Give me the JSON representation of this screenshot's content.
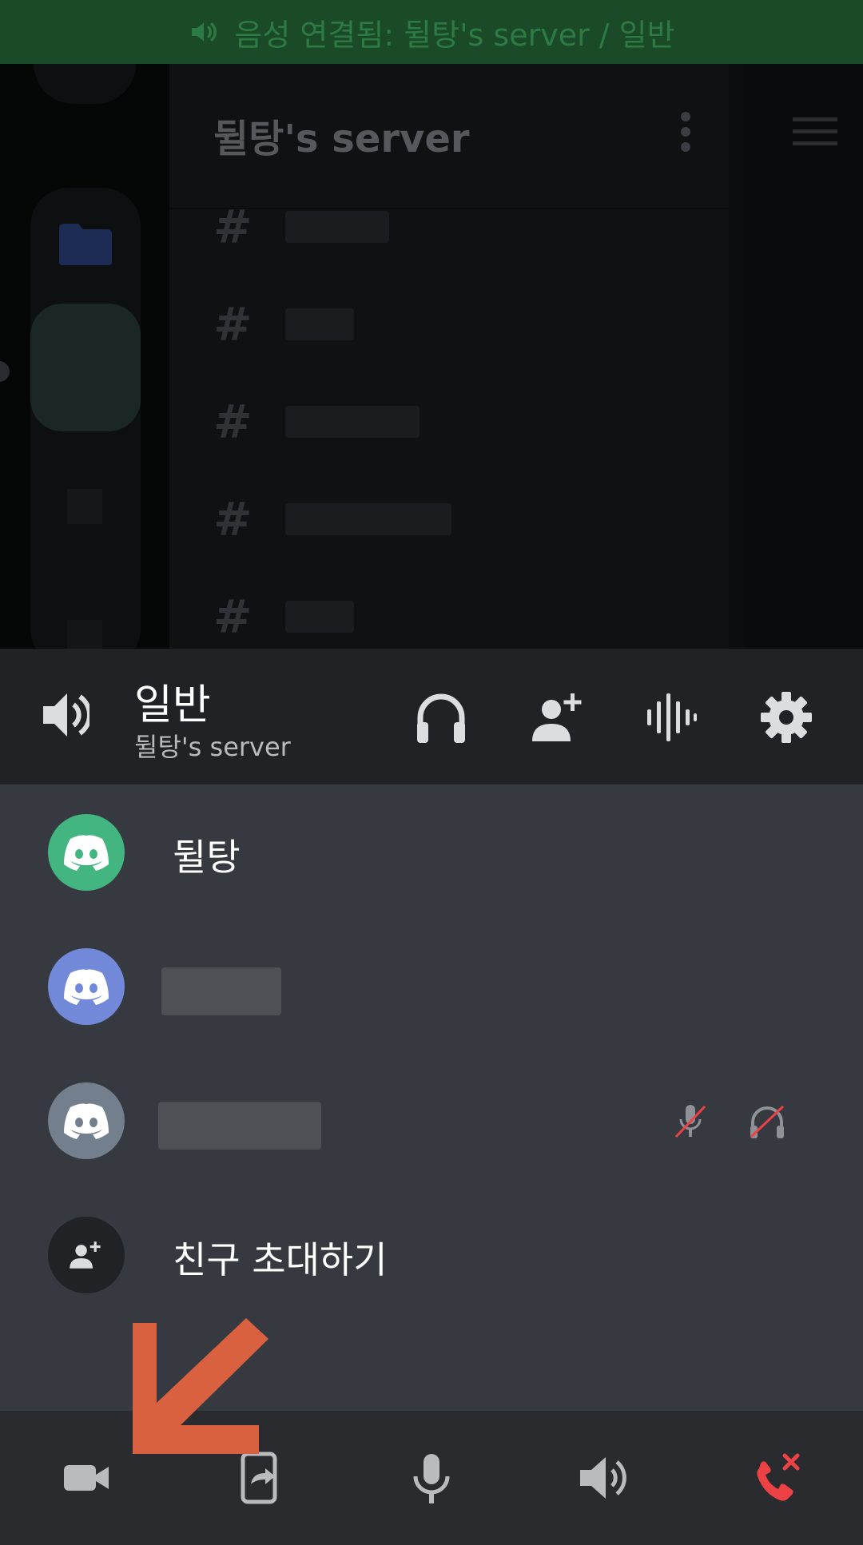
{
  "background_app": {
    "voice_banner": "음성 연결됨: 뒬탕's server / 일반",
    "server_name": "뒬탕's server",
    "channel_hash": "#"
  },
  "voice_panel": {
    "channel_name": "일반",
    "server_name": "뒬탕's server",
    "header_icons": [
      "speaker-icon",
      "headphones-icon",
      "add-person-icon",
      "soundwave-icon",
      "gear-icon"
    ]
  },
  "members": [
    {
      "name": "뒬탕",
      "avatar_color": "#43b581"
    },
    {
      "name": "",
      "avatar_color": "#7289da"
    },
    {
      "name": "",
      "avatar_color": "#747f8d",
      "muted": true,
      "deafened": true
    }
  ],
  "invite": {
    "label": "친구 초대하기"
  },
  "bottom_bar": {
    "buttons": [
      "camera-icon",
      "screen-share-icon",
      "microphone-icon",
      "speaker-icon",
      "disconnect-icon"
    ]
  },
  "colors": {
    "accent_red": "#ed4245",
    "annotation_arrow": "#d9613f",
    "sheet_bg": "#36393f",
    "header_bg": "#202225",
    "bottom_bar_bg": "#292b2f"
  }
}
